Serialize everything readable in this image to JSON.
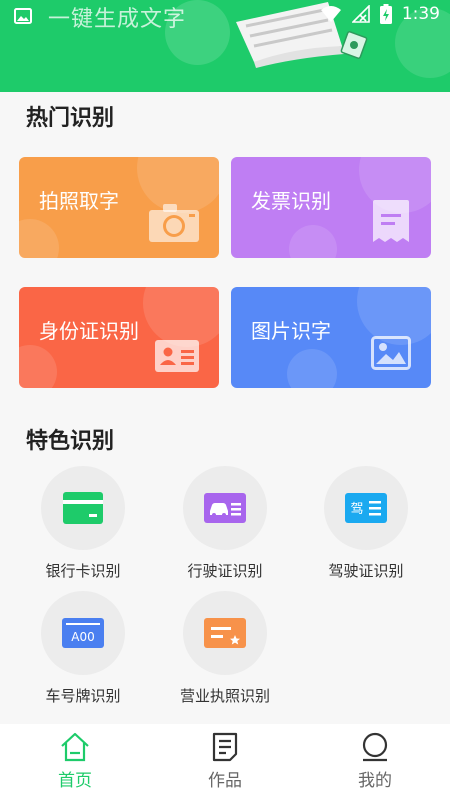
{
  "colors": {
    "accent": "#1ecb6a",
    "orange": "#f89e4a",
    "purple": "#bf7ef3",
    "red": "#fa6646",
    "blue": "#5789f7"
  },
  "status_bar": {
    "app_title": "一键生成文字",
    "time": "1:39"
  },
  "hot": {
    "title": "热门识别",
    "cards": [
      {
        "label": "拍照取字",
        "icon": "camera-icon"
      },
      {
        "label": "发票识别",
        "icon": "receipt-icon"
      },
      {
        "label": "身份证识别",
        "icon": "id-card-icon"
      },
      {
        "label": "图片识字",
        "icon": "image-icon"
      }
    ]
  },
  "features": {
    "title": "特色识别",
    "items": [
      {
        "label": "银行卡识别",
        "icon": "bank-card-icon"
      },
      {
        "label": "行驶证识别",
        "icon": "vehicle-license-icon"
      },
      {
        "label": "驾驶证识别",
        "icon": "driver-license-icon"
      },
      {
        "label": "车号牌识别",
        "icon": "license-plate-icon",
        "plate_text": "A00"
      },
      {
        "label": "营业执照识别",
        "icon": "business-license-icon"
      }
    ]
  },
  "bottom_nav": {
    "items": [
      {
        "label": "首页",
        "icon": "home-icon",
        "active": true
      },
      {
        "label": "作品",
        "icon": "document-icon",
        "active": false
      },
      {
        "label": "我的",
        "icon": "profile-icon",
        "active": false
      }
    ]
  },
  "driver_license_glyph": "驾"
}
